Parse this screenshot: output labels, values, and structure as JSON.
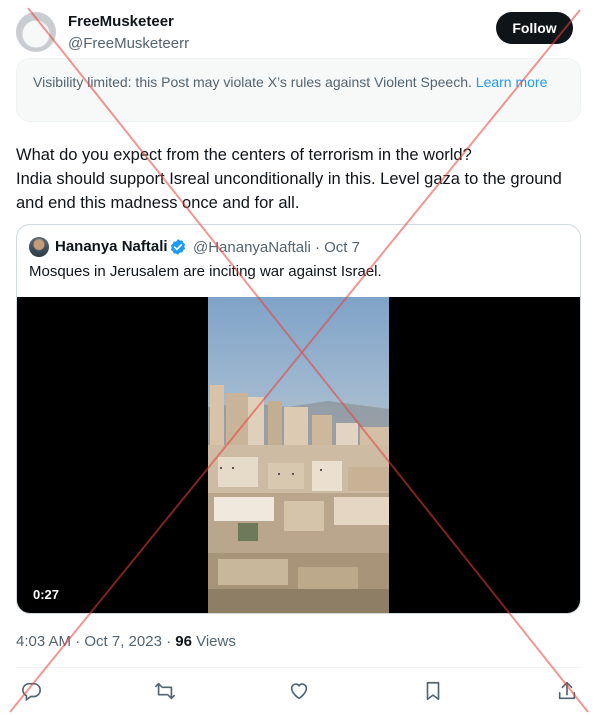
{
  "author": {
    "display_name": "FreeMusketeer",
    "handle": "@FreeMusketeerr"
  },
  "follow_button": {
    "label": "Follow"
  },
  "notice": {
    "text": "Visibility limited: this Post may violate X’s rules against Violent Speech.",
    "learn_more": "Learn more"
  },
  "post": {
    "lines": [
      "What do you expect from the centers of terrorism in the world?",
      "India should support Isreal unconditionally in this. Level gaza to the ground",
      "and end this madness once and for all."
    ]
  },
  "quoted_post": {
    "display_name": "Hananya Naftali",
    "handle_time": "@HananyaNaftali · Oct 7",
    "verified": true,
    "text": "Mosques in Jerusalem are inciting war against Israel.",
    "video": {
      "duration": "0:27"
    }
  },
  "meta": {
    "time": "4:03 AM · Oct 7, 2023 · ",
    "views_count": "96",
    "views_label": " Views"
  },
  "actions": [
    "reply-icon",
    "repost-icon",
    "like-icon",
    "bookmark-icon",
    "share-icon"
  ],
  "colors": {
    "accent": "#1d9bf0",
    "text": "#0f1419",
    "secondary": "#536471",
    "overlay_x": "#e8413c"
  }
}
